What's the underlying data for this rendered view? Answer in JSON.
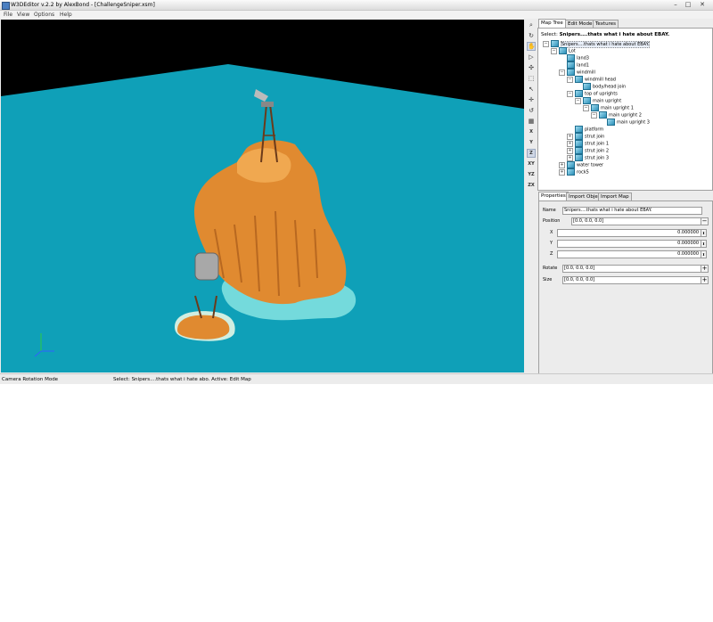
{
  "window": {
    "title": "W3DEditor v.2.2 by AlexBond - [ChallengeSniper.xsm]",
    "controls": {
      "minimize": "–",
      "maximize": "□",
      "close": "✕"
    }
  },
  "menu": [
    "File",
    "View",
    "Options",
    "Help"
  ],
  "toolbar": {
    "icons": [
      "zoom-icon",
      "rotate-icon",
      "camera-icon",
      "move-icon",
      "select-icon",
      "pointer-icon",
      "translate-icon",
      "rotate-object-icon",
      "scale-icon",
      "grid-icon"
    ],
    "axis_buttons": [
      "X",
      "Y",
      "Z",
      "XY",
      "YZ",
      "ZX"
    ]
  },
  "map_tree": {
    "tabs": [
      "Map Tree",
      "Edit Mode",
      "Textures"
    ],
    "select_prefix": "Select:",
    "select_value": "Snipers....thats what i hate about EBAY.",
    "nodes": [
      {
        "label": "Snipers....thats what i hate about EBAY.",
        "expand": "−"
      },
      {
        "label": "Lot",
        "expand": "−"
      },
      {
        "label": "land3",
        "expand": ""
      },
      {
        "label": "land1",
        "expand": ""
      },
      {
        "label": "windmill",
        "expand": "−"
      },
      {
        "label": "windmill head",
        "expand": "−"
      },
      {
        "label": "body/head join",
        "expand": ""
      },
      {
        "label": "top of uprights",
        "expand": "−"
      },
      {
        "label": "main upright",
        "expand": "−"
      },
      {
        "label": "main upright 1",
        "expand": "−"
      },
      {
        "label": "main upright 2",
        "expand": "−"
      },
      {
        "label": "main upright 3",
        "expand": ""
      },
      {
        "label": "platform",
        "expand": ""
      },
      {
        "label": "strut join",
        "expand": "+"
      },
      {
        "label": "strut join 1",
        "expand": "+"
      },
      {
        "label": "strut join 2",
        "expand": "+"
      },
      {
        "label": "strut join 3",
        "expand": "+"
      },
      {
        "label": "water tower",
        "expand": "+"
      },
      {
        "label": "rock5",
        "expand": "+"
      }
    ]
  },
  "properties": {
    "tabs": [
      "Properties",
      "Import Object",
      "Import Map"
    ],
    "name_label": "Name",
    "name_value": "Snipers....thats what i hate about EBAY.",
    "position_label": "Position",
    "position_value": "[0.0, 0.0, 0.0]",
    "position_button": "−",
    "x_label": "X",
    "x_value": "0.000000",
    "y_label": "Y",
    "y_value": "0.000000",
    "z_label": "Z",
    "z_value": "0.000000",
    "spin": "⬍",
    "rotate_label": "Rotate",
    "rotate_value": "[0.0, 0.0, 0.0]",
    "rotate_button": "+",
    "size_label": "Size",
    "size_value": "[0.0, 0.0, 0.0]",
    "size_button": "+"
  },
  "status": {
    "mode": "Camera Rotation Mode",
    "selection": "Select: Snipers....thats what i hate abo. Active: Edit Map"
  },
  "colors": {
    "sky": "#000000",
    "water": "#0fa0b8",
    "rock": "#e08a30",
    "foam": "#7fe0e0"
  }
}
